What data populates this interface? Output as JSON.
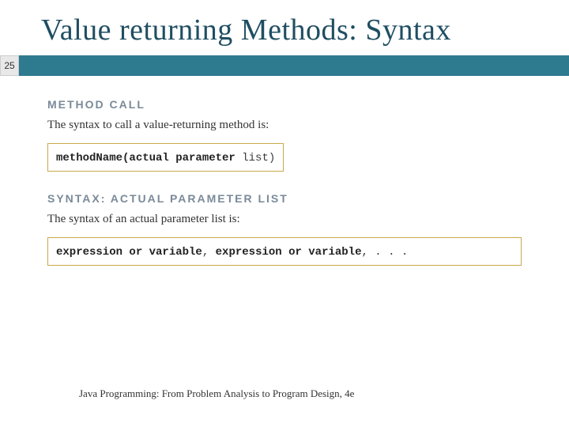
{
  "slide": {
    "title": "Value returning Methods: Syntax",
    "pageNumber": "25"
  },
  "sections": {
    "methodCall": {
      "heading": "METHOD CALL",
      "text": "The syntax to call a value-returning method is:",
      "codeBold": "methodName(actual parameter",
      "codePlain": " list)"
    },
    "paramList": {
      "heading": "SYNTAX: ACTUAL PARAMETER LIST",
      "text": "The syntax of an actual parameter list is:",
      "code1Bold": "expression or variable",
      "codeComma1": ", ",
      "code2Bold": "expression or variable",
      "codeTail": ", . . ."
    }
  },
  "footer": {
    "text": "Java Programming: From Problem Analysis to Program Design, 4e"
  }
}
